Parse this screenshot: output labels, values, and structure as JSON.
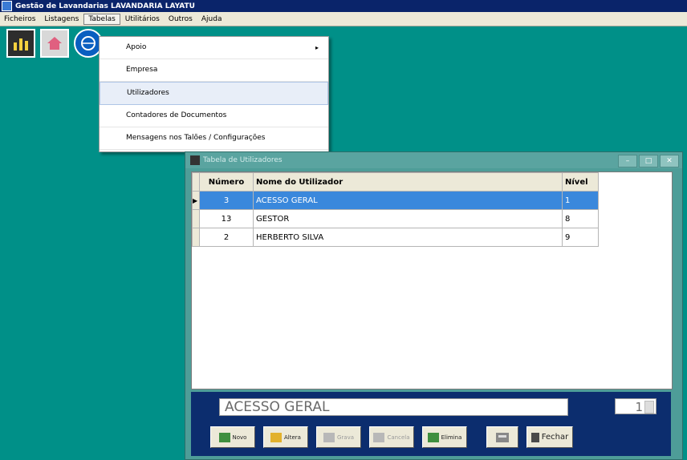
{
  "app": {
    "title": "Gestão de Lavandarias   LAVANDARIA LAYATU"
  },
  "menubar": {
    "items": [
      "Ficheiros",
      "Listagens",
      "Tabelas",
      "Utilitários",
      "Outros",
      "Ajuda"
    ],
    "active": "Tabelas"
  },
  "dropdown": {
    "items": [
      {
        "label": "Apoio",
        "submenu_arrow": "▸"
      },
      {
        "label": "Empresa"
      },
      {
        "label": "Utilizadores"
      },
      {
        "label": "Contadores de Documentos"
      },
      {
        "label": "Mensagens nos Talões / Configurações"
      }
    ],
    "selected": "Utilizadores"
  },
  "window": {
    "title": "Tabela de Utilizadores",
    "controls": {
      "minimize": "–",
      "maximize": "□",
      "close": "✕"
    },
    "columns": [
      "Número",
      "Nome do Utilizador",
      "Nível"
    ],
    "rows": [
      {
        "numero": "3",
        "nome": "ACESSO GERAL",
        "nivel": "1",
        "selected": true
      },
      {
        "numero": "13",
        "nome": "GESTOR",
        "nivel": "8",
        "selected": false
      },
      {
        "numero": "2",
        "nome": "HERBERTO SILVA",
        "nivel": "9",
        "selected": false
      }
    ],
    "current_name": "ACESSO GERAL",
    "current_level": "1",
    "buttons": {
      "novo": "Novo",
      "altera": "Altera",
      "grava": "Grava",
      "cancela": "Cancela",
      "elimina": "Elimina",
      "fechar": "Fechar"
    }
  },
  "icons": {
    "toolbar": [
      "toolbar-chart-icon",
      "toolbar-house-icon",
      "toolbar-globe-icon"
    ]
  }
}
